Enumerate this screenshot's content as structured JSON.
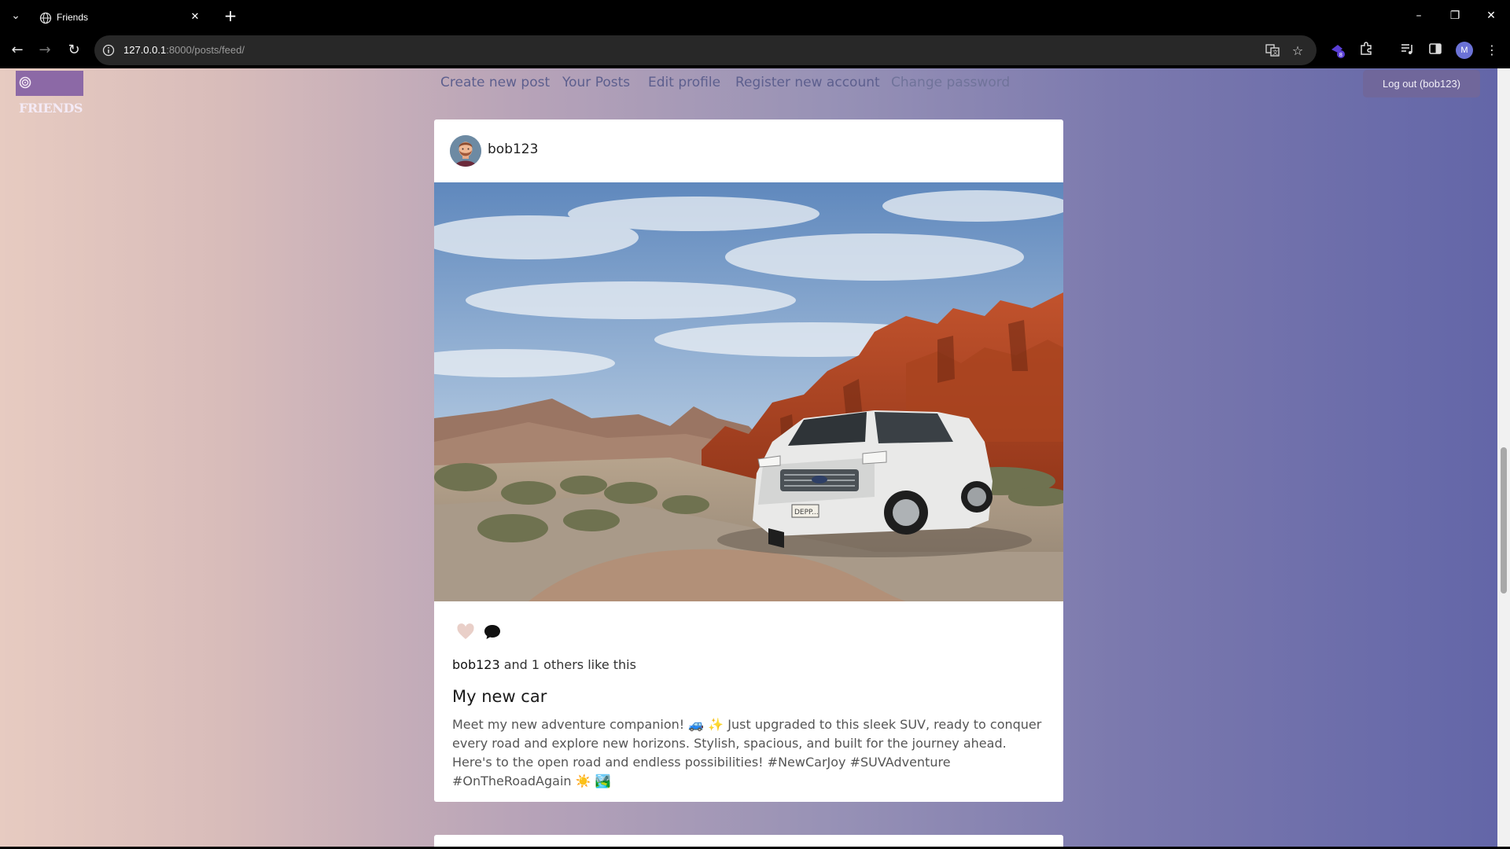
{
  "browser": {
    "tab_title": "Friends",
    "url_host": "127.0.0.1",
    "url_path": ":8000/posts/feed/",
    "extension_badge": "8",
    "profile_initial": "M"
  },
  "site": {
    "logo_text": "FRIENDS",
    "nav": [
      {
        "label": "Create new post"
      },
      {
        "label": "Your Posts"
      },
      {
        "label": "Edit profile"
      },
      {
        "label": "Register new account"
      },
      {
        "label": "Change password"
      }
    ],
    "logout_label": "Log out (bob123)"
  },
  "post": {
    "author": "bob123",
    "liked_by": "bob123",
    "likes_suffix": " and 1 others like this",
    "title": "My new car",
    "body": "Meet my new adventure companion! 🚙 ✨ Just upgraded to this sleek SUV, ready to conquer every road and explore new horizons. Stylish, spacious, and built for the journey ahead. Here's to the open road and endless possibilities! #NewCarJoy #SUVAdventure #OnTheRoadAgain ☀️ 🏞️",
    "plate": "DEPP..."
  },
  "colors": {
    "nav_link": "#5d5f8e",
    "logout_bg": "#70679b",
    "logo_bg": "#8c69a6",
    "heart": "#e9cfc8"
  },
  "icons": {
    "tab_favicon": "globe-icon",
    "heart": "heart-icon",
    "comment": "speech-bubble-icon"
  }
}
